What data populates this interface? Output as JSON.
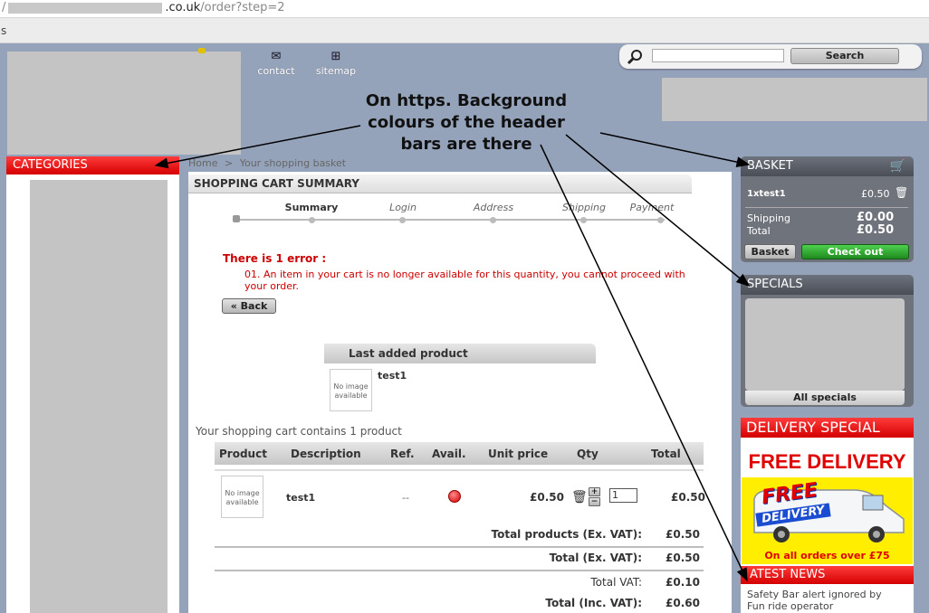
{
  "browser": {
    "url_prefix": "/",
    "url_host_suffix": ".co.uk",
    "url_path": "/order?step=2",
    "toolbar_fragment": "s"
  },
  "header": {
    "nav": [
      {
        "label": "contact",
        "icon": "envelope-icon"
      },
      {
        "label": "sitemap",
        "icon": "sitemap-icon"
      }
    ],
    "search": {
      "input_value": "",
      "button_label": "Search"
    }
  },
  "annotation": {
    "text_line1": "On https. Background",
    "text_line2": "colours of the header",
    "text_line3": "bars are there"
  },
  "left_sidebar": {
    "categories_title": "CATEGORIES"
  },
  "breadcrumb": {
    "home": "Home",
    "separator": ">",
    "current": "Your shopping basket"
  },
  "cart_summary": {
    "title": "SHOPPING CART SUMMARY",
    "steps": [
      "Summary",
      "Login",
      "Address",
      "Shipping",
      "Payment"
    ],
    "error_title": "There is 1 error :",
    "error_message_line1": "01. An item in your cart is no longer available for this quantity, you cannot proceed with",
    "error_message_line2": "your order.",
    "back_button": "« Back",
    "last_added_title": "Last added product",
    "last_added_name": "test1",
    "no_image_line1": "No image",
    "no_image_line2": "available",
    "contains_text": "Your shopping cart contains 1 product"
  },
  "cart_table": {
    "headers": [
      "Product",
      "Description",
      "Ref.",
      "Avail.",
      "Unit price",
      "Qty",
      "Total"
    ],
    "rows": [
      {
        "description": "test1",
        "ref": "--",
        "unit_price": "£0.50",
        "qty": "1",
        "total": "£0.50"
      }
    ],
    "qty_plus": "+",
    "qty_minus": "−",
    "totals": [
      {
        "label": "Total products (Ex. VAT):",
        "value": "£0.50"
      },
      {
        "label": "Total (Ex. VAT):",
        "value": "£0.50"
      },
      {
        "label": "Total VAT:",
        "value": "£0.10"
      },
      {
        "label": "Total (Inc. VAT):",
        "value": "£0.60"
      }
    ]
  },
  "basket": {
    "title": "BASKET",
    "item_qty": "1",
    "item_times": "x",
    "item_name": "test1",
    "item_price": "£0.50",
    "shipping_label": "Shipping",
    "shipping_value": "£0.00",
    "total_label": "Total",
    "total_value": "£0.50",
    "basket_button": "Basket",
    "checkout_button": "Check out"
  },
  "specials": {
    "title": "SPECIALS",
    "all_link": "All specials"
  },
  "delivery_special": {
    "title": "DELIVERY SPECIAL",
    "headline": "FREE DELIVERY",
    "van_word1": "FREE",
    "van_word2": "DELIVERY",
    "caption": "On all orders over £75"
  },
  "latest_news": {
    "title": "ATEST NEWS",
    "item_line1": "Safety Bar alert ignored by",
    "item_line2": "Fun ride operator"
  },
  "colors": {
    "red_header": "#e00000",
    "grey_header": "#5a5e66",
    "page_bg": "#94a3ba",
    "checkout_green": "#2aa52a",
    "error_red": "#cc0000"
  }
}
